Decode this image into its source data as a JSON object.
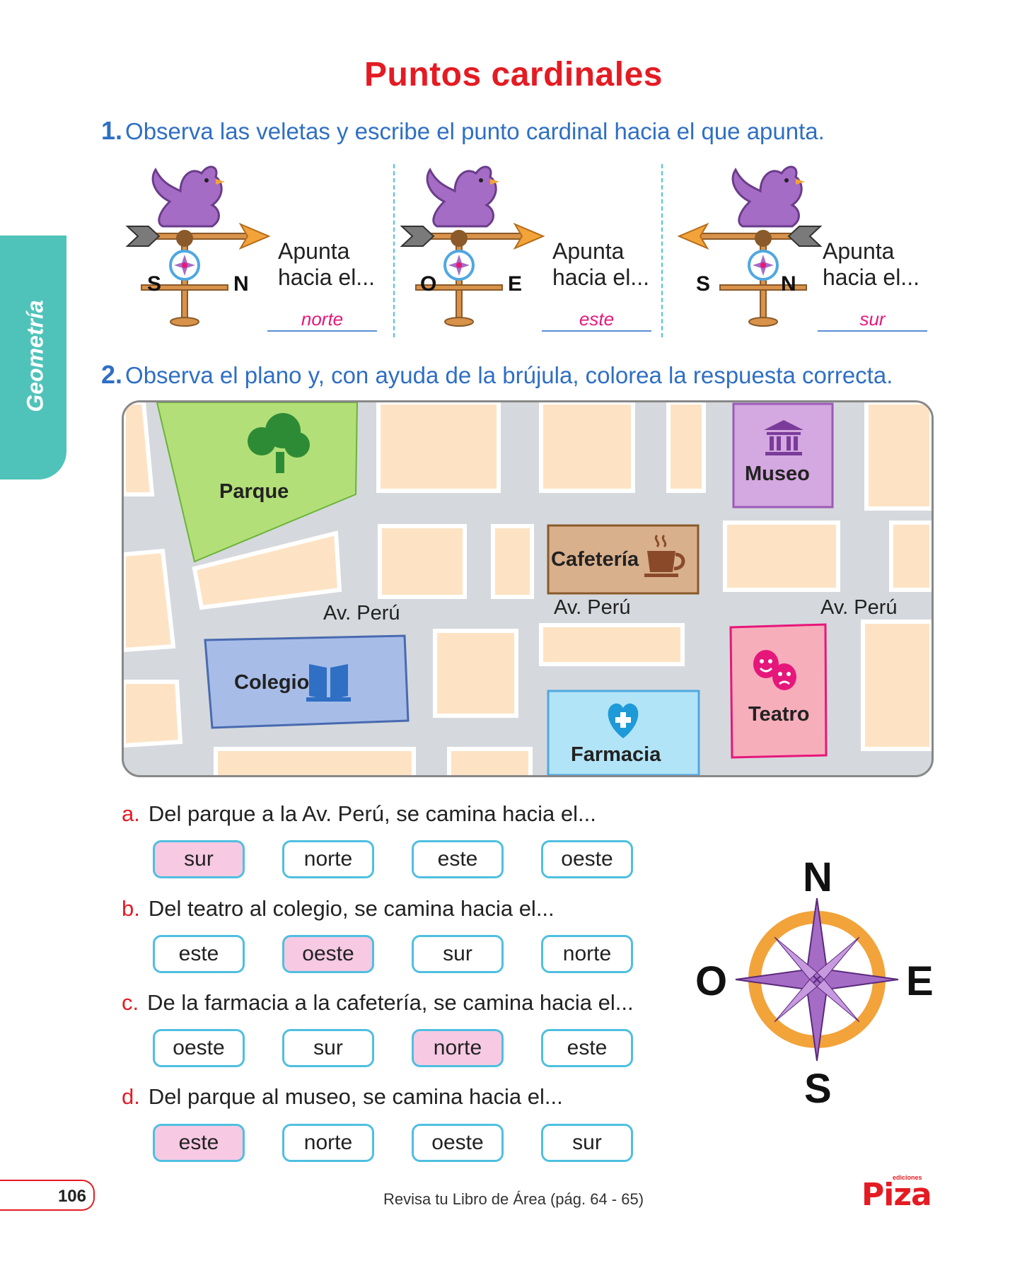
{
  "title": "Puntos cardinales",
  "side_tab": "Geometría",
  "q1": {
    "number": "1.",
    "text": "Observa las veletas y escribe el punto cardinal hacia el que apunta.",
    "vanes": [
      {
        "left": "S",
        "right": "N",
        "label1": "Apunta",
        "label2": "hacia el...",
        "answer": "norte"
      },
      {
        "left": "O",
        "right": "E",
        "label1": "Apunta",
        "label2": "hacia el...",
        "answer": "este"
      },
      {
        "left": "S",
        "right": "N",
        "label1": "Apunta",
        "label2": "hacia el...",
        "answer": "sur"
      }
    ]
  },
  "q2": {
    "number": "2.",
    "text": "Observa el plano y, con ayuda de la brújula, colorea la respuesta correcta."
  },
  "map": {
    "parque": "Parque",
    "museo": "Museo",
    "cafeteria": "Cafetería",
    "colegio": "Colegio",
    "teatro": "Teatro",
    "farmacia": "Farmacia",
    "street": "Av. Perú"
  },
  "questions": [
    {
      "letter": "a.",
      "text": "Del parque a la Av. Perú, se camina hacia el...",
      "options": [
        "sur",
        "norte",
        "este",
        "oeste"
      ],
      "selected": 0
    },
    {
      "letter": "b.",
      "text": "Del teatro al colegio, se camina hacia el...",
      "options": [
        "este",
        "oeste",
        "sur",
        "norte"
      ],
      "selected": 1
    },
    {
      "letter": "c.",
      "text": "De la farmacia a la cafetería, se camina hacia el...",
      "options": [
        "oeste",
        "sur",
        "norte",
        "este"
      ],
      "selected": 2
    },
    {
      "letter": "d.",
      "text": "Del parque al museo, se camina hacia el...",
      "options": [
        "este",
        "norte",
        "oeste",
        "sur"
      ],
      "selected": 0
    }
  ],
  "compass": {
    "n": "N",
    "s": "S",
    "e": "E",
    "o": "O"
  },
  "footer": {
    "page": "106",
    "text": "Revisa tu Libro de Área (pág. 64 - 65)",
    "logo": "Piza",
    "logo_small": "ediciones"
  },
  "colors": {
    "title": "#e41b23",
    "accent_blue": "#2f6fc4",
    "tab": "#4fc3b9",
    "selected": "#f7c9e3"
  }
}
